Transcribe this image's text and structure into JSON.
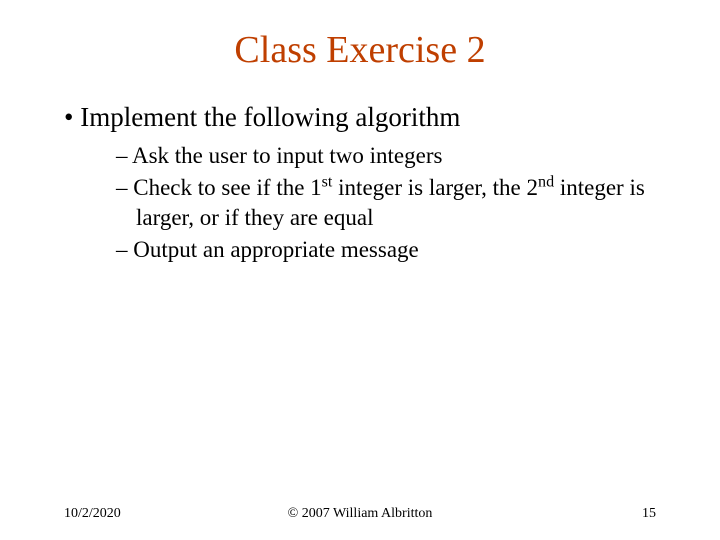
{
  "title": "Class Exercise 2",
  "main_bullet": "Implement the following algorithm",
  "sub": {
    "item1": "Ask the user to input two integers",
    "item2_pre": "Check to see if the 1",
    "item2_sup1": "st",
    "item2_mid": " integer is larger, the 2",
    "item2_sup2": "nd",
    "item2_post": " integer is larger, or if they are equal",
    "item3": "Output an appropriate message"
  },
  "footer": {
    "date": "10/2/2020",
    "copyright": "© 2007 William Albritton",
    "page": "15"
  }
}
